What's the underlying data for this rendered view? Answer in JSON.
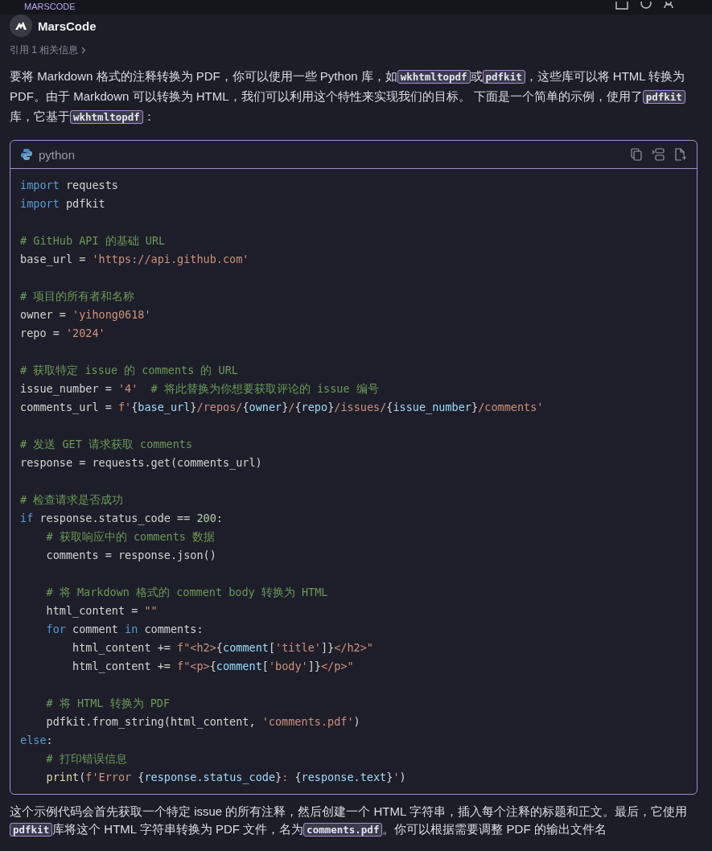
{
  "top_bar": {
    "title": "MARSCODE"
  },
  "message": {
    "author": "MarsCode",
    "references": "引用 1 相关信息",
    "intro": [
      {
        "kind": "text",
        "text": "要将 Markdown 格式的注释转换为 PDF，你可以使用一些 Python 库，如"
      },
      {
        "kind": "code",
        "text": "wkhtmltopdf"
      },
      {
        "kind": "text",
        "text": "或"
      },
      {
        "kind": "code",
        "text": "pdfkit"
      },
      {
        "kind": "text",
        "text": "，这些库可以将 HTML 转换为 PDF。由于 Markdown 可以转换为 HTML，我们可以利用这个特性来实现我们的目标。 下面是一个简单的示例，使用了"
      },
      {
        "kind": "code",
        "text": "pdfkit"
      },
      {
        "kind": "text",
        "text": "库，它基于"
      },
      {
        "kind": "code",
        "text": "wkhtmltopdf"
      },
      {
        "kind": "text",
        "text": "："
      }
    ],
    "code_block": {
      "language": "python",
      "lines": [
        {
          "kind": "code",
          "tokens": [
            {
              "kind": "kw",
              "s": "import"
            },
            {
              "kind": "plain",
              "s": " requests"
            }
          ]
        },
        {
          "kind": "code",
          "tokens": [
            {
              "kind": "kw",
              "s": "import"
            },
            {
              "kind": "plain",
              "s": " pdfkit"
            }
          ]
        },
        {
          "kind": "blank"
        },
        {
          "kind": "code",
          "tokens": [
            {
              "kind": "cmt",
              "s": "# GitHub API 的基础 URL"
            }
          ]
        },
        {
          "kind": "code",
          "tokens": [
            {
              "kind": "plain",
              "s": "base_url = "
            },
            {
              "kind": "str",
              "s": "'https://api.github.com'"
            }
          ]
        },
        {
          "kind": "blank"
        },
        {
          "kind": "code",
          "tokens": [
            {
              "kind": "cmt",
              "s": "# 项目的所有者和名称"
            }
          ]
        },
        {
          "kind": "code",
          "tokens": [
            {
              "kind": "plain",
              "s": "owner = "
            },
            {
              "kind": "str",
              "s": "'yihong0618'"
            }
          ]
        },
        {
          "kind": "code",
          "tokens": [
            {
              "kind": "plain",
              "s": "repo = "
            },
            {
              "kind": "str",
              "s": "'2024'"
            }
          ]
        },
        {
          "kind": "blank"
        },
        {
          "kind": "code",
          "tokens": [
            {
              "kind": "cmt",
              "s": "# 获取特定 issue 的 comments 的 URL"
            }
          ]
        },
        {
          "kind": "code",
          "tokens": [
            {
              "kind": "plain",
              "s": "issue_number = "
            },
            {
              "kind": "str",
              "s": "'4'"
            },
            {
              "kind": "cmt",
              "s": "  # 将此替换为你想要获取评论的 issue 编号"
            }
          ]
        },
        {
          "kind": "code",
          "tokens": [
            {
              "kind": "plain",
              "s": "comments_url = "
            },
            {
              "kind": "str",
              "s": "f'"
            },
            {
              "kind": "plain",
              "s": "{"
            },
            {
              "kind": "var",
              "s": "base_url"
            },
            {
              "kind": "plain",
              "s": "}"
            },
            {
              "kind": "str",
              "s": "/repos/"
            },
            {
              "kind": "plain",
              "s": "{"
            },
            {
              "kind": "var",
              "s": "owner"
            },
            {
              "kind": "plain",
              "s": "}"
            },
            {
              "kind": "str",
              "s": "/"
            },
            {
              "kind": "plain",
              "s": "{"
            },
            {
              "kind": "var",
              "s": "repo"
            },
            {
              "kind": "plain",
              "s": "}"
            },
            {
              "kind": "str",
              "s": "/issues/"
            },
            {
              "kind": "plain",
              "s": "{"
            },
            {
              "kind": "var",
              "s": "issue_number"
            },
            {
              "kind": "plain",
              "s": "}"
            },
            {
              "kind": "str",
              "s": "/comments'"
            }
          ]
        },
        {
          "kind": "blank"
        },
        {
          "kind": "code",
          "tokens": [
            {
              "kind": "cmt",
              "s": "# 发送 GET 请求获取 comments"
            }
          ]
        },
        {
          "kind": "code",
          "tokens": [
            {
              "kind": "plain",
              "s": "response = requests.get(comments_url)"
            }
          ]
        },
        {
          "kind": "blank"
        },
        {
          "kind": "code",
          "tokens": [
            {
              "kind": "cmt",
              "s": "# 检查请求是否成功"
            }
          ]
        },
        {
          "kind": "code",
          "tokens": [
            {
              "kind": "kw",
              "s": "if"
            },
            {
              "kind": "plain",
              "s": " response.status_code == "
            },
            {
              "kind": "num",
              "s": "200"
            },
            {
              "kind": "plain",
              "s": ":"
            }
          ]
        },
        {
          "kind": "code",
          "tokens": [
            {
              "kind": "cmt",
              "s": "    # 获取响应中的 comments 数据"
            }
          ]
        },
        {
          "kind": "code",
          "tokens": [
            {
              "kind": "plain",
              "s": "    comments = response.json()"
            }
          ]
        },
        {
          "kind": "blank"
        },
        {
          "kind": "code",
          "tokens": [
            {
              "kind": "cmt",
              "s": "    # 将 Markdown 格式的 comment body 转换为 HTML"
            }
          ]
        },
        {
          "kind": "code",
          "tokens": [
            {
              "kind": "plain",
              "s": "    html_content = "
            },
            {
              "kind": "str",
              "s": "\"\""
            }
          ]
        },
        {
          "kind": "code",
          "tokens": [
            {
              "kind": "kw",
              "s": "    for"
            },
            {
              "kind": "plain",
              "s": " comment "
            },
            {
              "kind": "kw",
              "s": "in"
            },
            {
              "kind": "plain",
              "s": " comments:"
            }
          ]
        },
        {
          "kind": "code",
          "tokens": [
            {
              "kind": "plain",
              "s": "        html_content += "
            },
            {
              "kind": "str",
              "s": "f\"<h2>"
            },
            {
              "kind": "plain",
              "s": "{"
            },
            {
              "kind": "var",
              "s": "comment"
            },
            {
              "kind": "plain",
              "s": "["
            },
            {
              "kind": "str",
              "s": "'title'"
            },
            {
              "kind": "plain",
              "s": "]}"
            },
            {
              "kind": "str",
              "s": "</h2>\""
            }
          ]
        },
        {
          "kind": "code",
          "tokens": [
            {
              "kind": "plain",
              "s": "        html_content += "
            },
            {
              "kind": "str",
              "s": "f\"<p>"
            },
            {
              "kind": "plain",
              "s": "{"
            },
            {
              "kind": "var",
              "s": "comment"
            },
            {
              "kind": "plain",
              "s": "["
            },
            {
              "kind": "str",
              "s": "'body'"
            },
            {
              "kind": "plain",
              "s": "]}"
            },
            {
              "kind": "str",
              "s": "</p>\""
            }
          ]
        },
        {
          "kind": "blank"
        },
        {
          "kind": "code",
          "tokens": [
            {
              "kind": "cmt",
              "s": "    # 将 HTML 转换为 PDF"
            }
          ]
        },
        {
          "kind": "code",
          "tokens": [
            {
              "kind": "plain",
              "s": "    pdfkit.from_string(html_content, "
            },
            {
              "kind": "str",
              "s": "'comments.pdf'"
            },
            {
              "kind": "plain",
              "s": ")"
            }
          ]
        },
        {
          "kind": "code",
          "tokens": [
            {
              "kind": "kw",
              "s": "else"
            },
            {
              "kind": "plain",
              "s": ":"
            }
          ]
        },
        {
          "kind": "code",
          "tokens": [
            {
              "kind": "cmt",
              "s": "    # 打印错误信息"
            }
          ]
        },
        {
          "kind": "code",
          "tokens": [
            {
              "kind": "fn",
              "s": "    print"
            },
            {
              "kind": "plain",
              "s": "("
            },
            {
              "kind": "str",
              "s": "f'Error "
            },
            {
              "kind": "plain",
              "s": "{"
            },
            {
              "kind": "var",
              "s": "response.status_code"
            },
            {
              "kind": "plain",
              "s": "}"
            },
            {
              "kind": "str",
              "s": ": "
            },
            {
              "kind": "plain",
              "s": "{"
            },
            {
              "kind": "var",
              "s": "response.text"
            },
            {
              "kind": "plain",
              "s": "}"
            },
            {
              "kind": "str",
              "s": "'"
            },
            {
              "kind": "plain",
              "s": ")"
            }
          ]
        }
      ]
    },
    "outro": [
      {
        "kind": "text",
        "text": "这个示例代码会首先获取一个特定 issue 的所有注释，然后创建一个 HTML 字符串，插入每个注释的标题和正文。最后，它使用"
      },
      {
        "kind": "code",
        "text": "pdfkit"
      },
      {
        "kind": "text",
        "text": "库将这个 HTML 字符串转换为 PDF 文件，名为"
      },
      {
        "kind": "code",
        "text": "comments.pdf"
      },
      {
        "kind": "text",
        "text": "。你可以根据需要调整 PDF 的输出文件名"
      }
    ]
  }
}
